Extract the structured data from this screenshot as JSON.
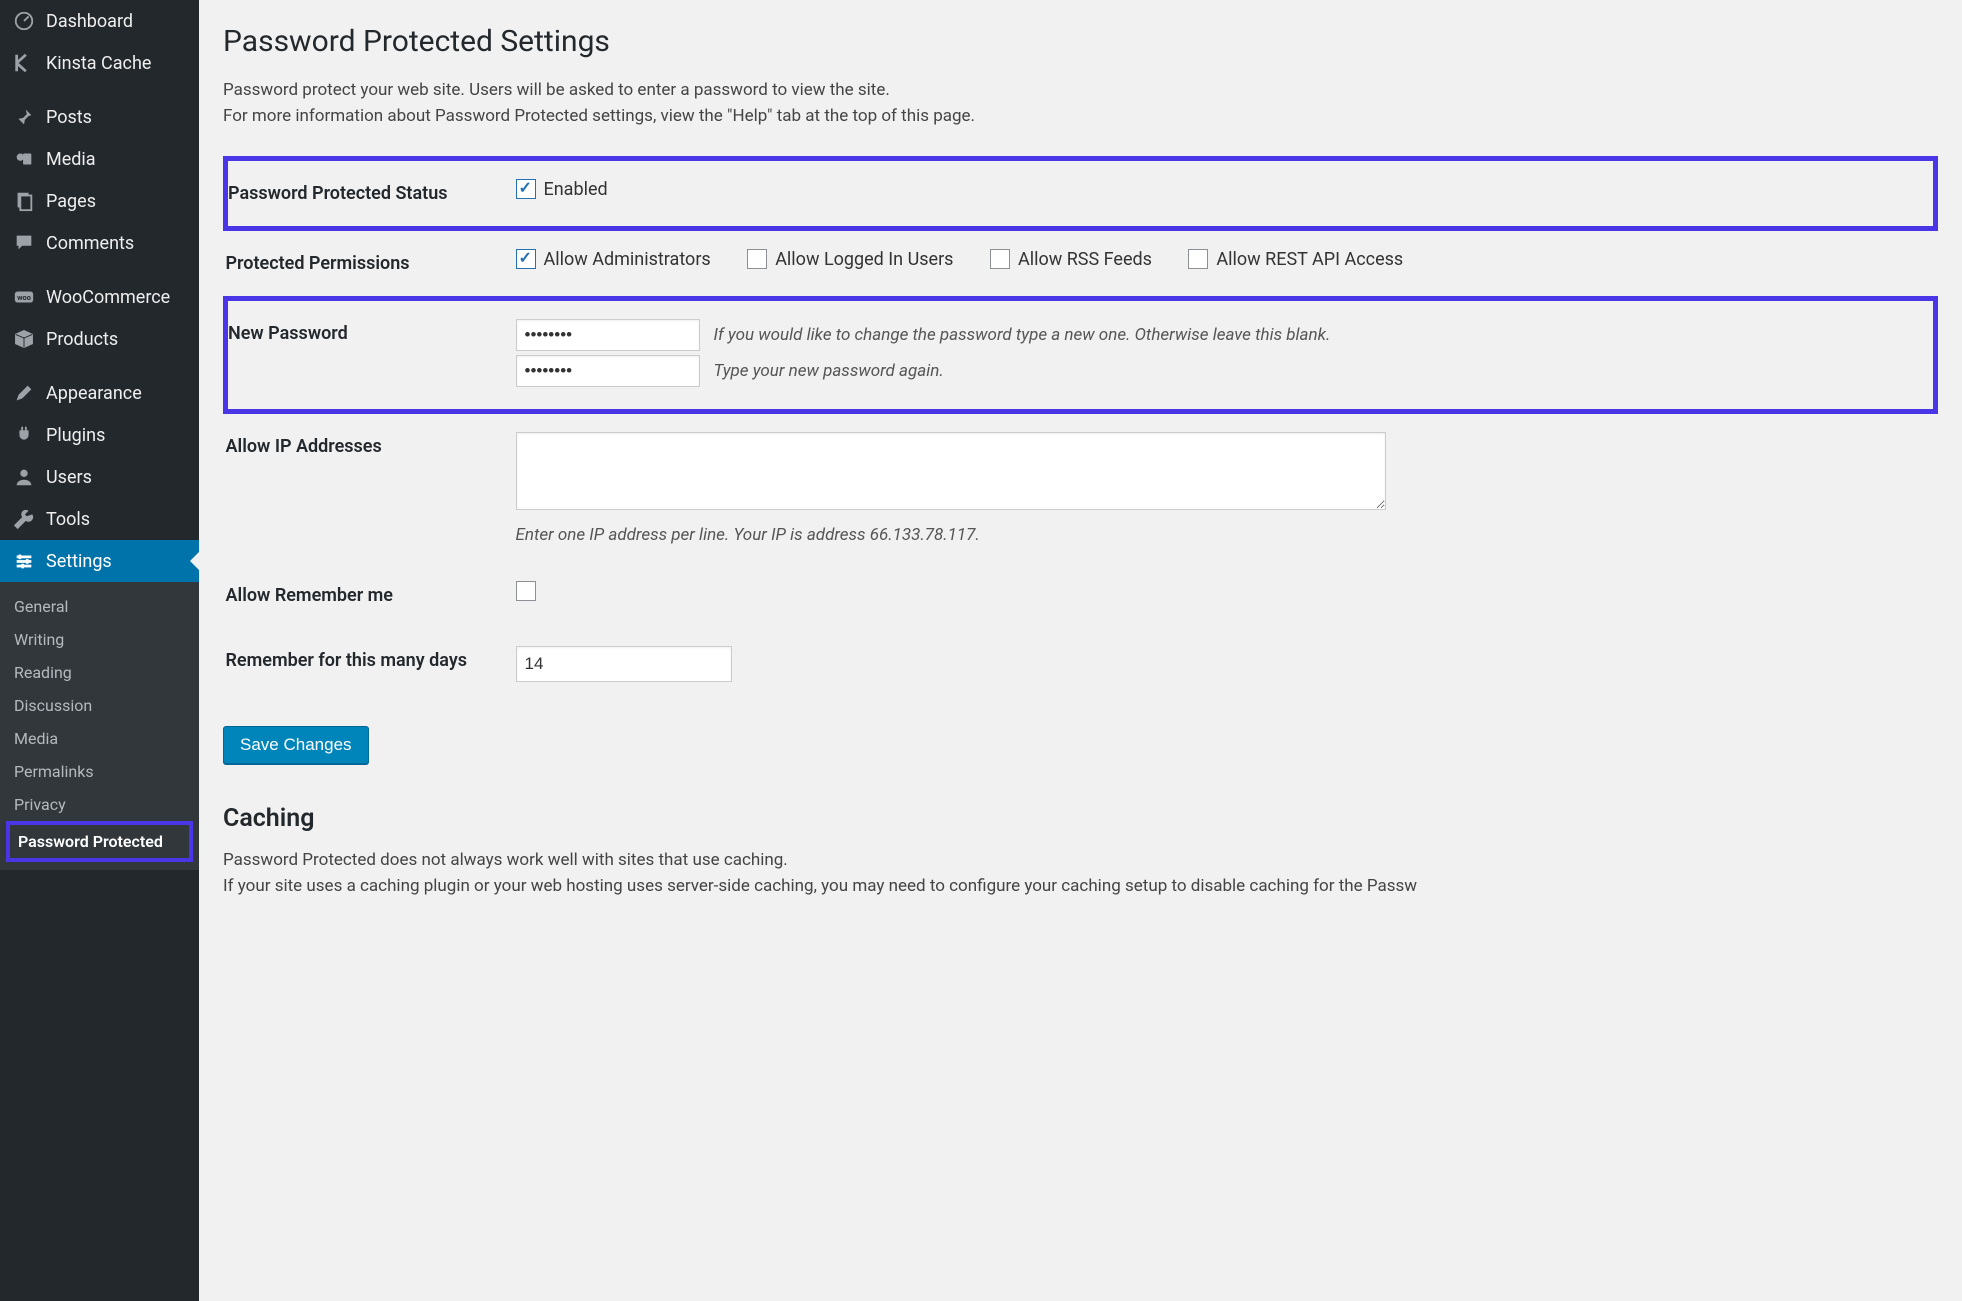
{
  "sidebar": {
    "items": [
      {
        "label": "Dashboard",
        "icon": "dashboard-icon"
      },
      {
        "label": "Kinsta Cache",
        "icon": "kinsta-icon"
      },
      {
        "label": "Posts",
        "icon": "pin-icon"
      },
      {
        "label": "Media",
        "icon": "media-icon"
      },
      {
        "label": "Pages",
        "icon": "pages-icon"
      },
      {
        "label": "Comments",
        "icon": "comments-icon"
      },
      {
        "label": "WooCommerce",
        "icon": "woo-icon"
      },
      {
        "label": "Products",
        "icon": "products-icon"
      },
      {
        "label": "Appearance",
        "icon": "appearance-icon"
      },
      {
        "label": "Plugins",
        "icon": "plugins-icon"
      },
      {
        "label": "Users",
        "icon": "users-icon"
      },
      {
        "label": "Tools",
        "icon": "tools-icon"
      },
      {
        "label": "Settings",
        "icon": "settings-icon"
      }
    ],
    "subitems": [
      {
        "label": "General"
      },
      {
        "label": "Writing"
      },
      {
        "label": "Reading"
      },
      {
        "label": "Discussion"
      },
      {
        "label": "Media"
      },
      {
        "label": "Permalinks"
      },
      {
        "label": "Privacy"
      },
      {
        "label": "Password Protected"
      }
    ]
  },
  "page": {
    "title": "Password Protected Settings",
    "desc1": "Password protect your web site. Users will be asked to enter a password to view the site.",
    "desc2": "For more information about Password Protected settings, view the \"Help\" tab at the top of this page."
  },
  "fields": {
    "status_label": "Password Protected Status",
    "status_enabled": "Enabled",
    "perm_label": "Protected Permissions",
    "perm_admin": "Allow Administrators",
    "perm_logged": "Allow Logged In Users",
    "perm_rss": "Allow RSS Feeds",
    "perm_rest": "Allow REST API Access",
    "newpwd_label": "New Password",
    "pwd_hint1": "If you would like to change the password type a new one. Otherwise leave this blank.",
    "pwd_hint2": "Type your new password again.",
    "pwd_value": "••••••••",
    "ip_label": "Allow IP Addresses",
    "ip_hint": "Enter one IP address per line. Your IP is address 66.133.78.117.",
    "remember_label": "Allow Remember me",
    "days_label": "Remember for this many days",
    "days_value": "14",
    "save_label": "Save Changes"
  },
  "caching": {
    "heading": "Caching",
    "p1": "Password Protected does not always work well with sites that use caching.",
    "p2": "If your site uses a caching plugin or your web hosting uses server-side caching, you may need to configure your caching setup to disable caching for the Passw"
  }
}
